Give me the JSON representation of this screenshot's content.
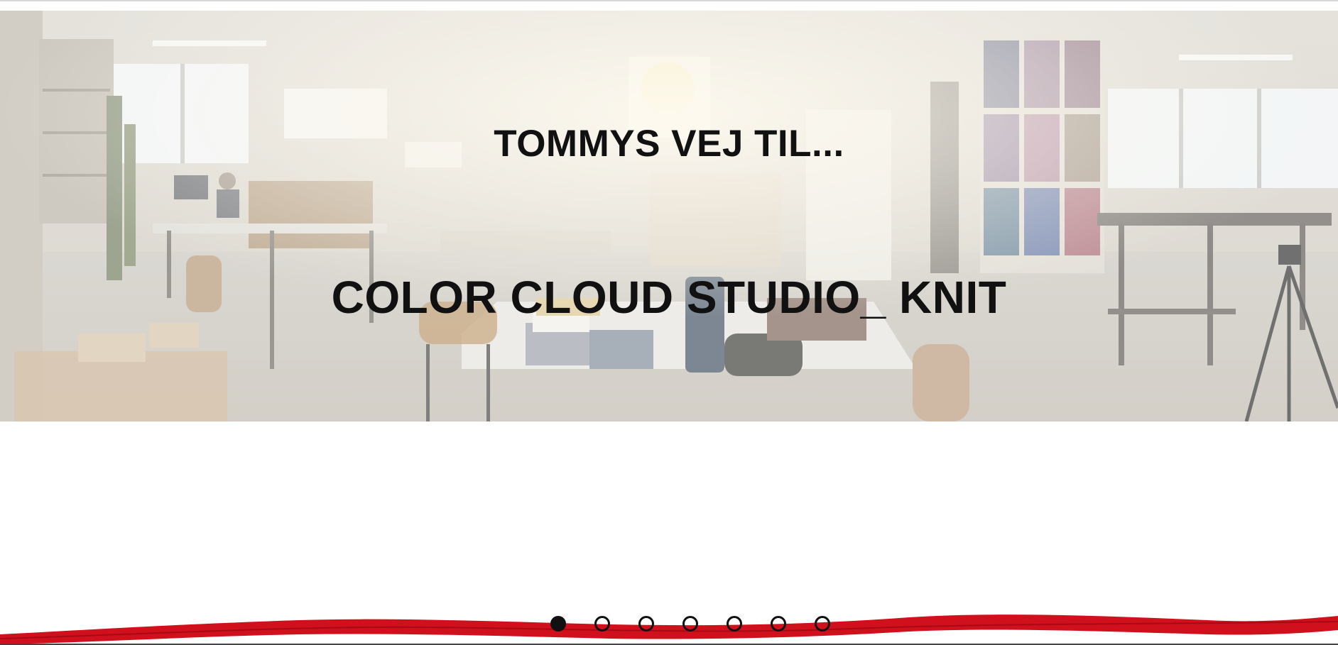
{
  "hero": {
    "subtitle": "TOMMYS VEJ TIL...",
    "title": "COLOR CLOUD STUDIO_ KNIT"
  },
  "carousel": {
    "slide_count": 7,
    "active_index": 0
  },
  "colors": {
    "yarn": "#d0101c",
    "text": "#111111",
    "dot": "#111111"
  }
}
